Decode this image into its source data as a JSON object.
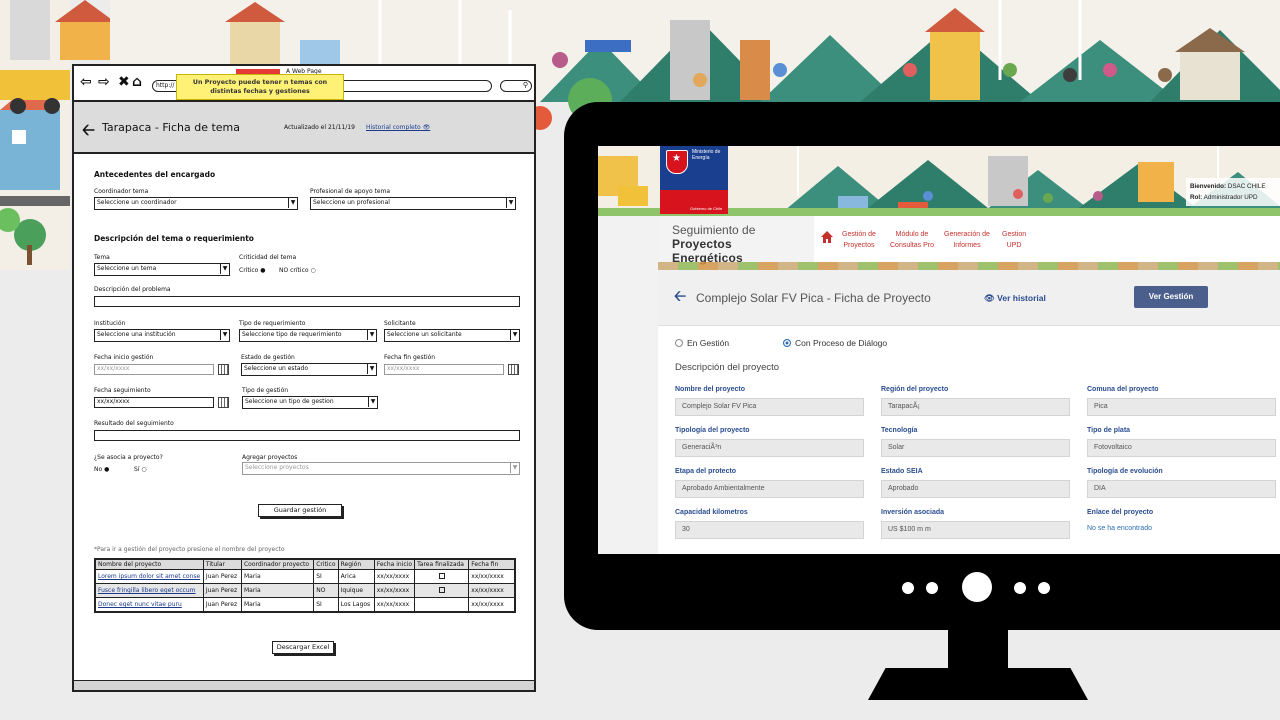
{
  "wireframe": {
    "browser": {
      "nav_icons": [
        "back-arrow-icon",
        "forward-arrow-icon",
        "close-icon",
        "home-icon"
      ],
      "url": "http://",
      "tab_title": "A Web Page",
      "search_icon": "search-icon"
    },
    "sticky_note": "Un Proyecto puede tener n temas con distintas fechas y gestiones",
    "header": {
      "title": "Tarapaca - Ficha de tema",
      "updated": "Actualizado el 21/11/19",
      "history_link": "Historial completo",
      "history_icon": "eye-icon"
    },
    "section1": {
      "title": "Antecedentes del encargado",
      "coordinator_label": "Coordinador tema",
      "coordinator_value": "Seleccione un coordinador",
      "support_label": "Profesional de apoyo tema",
      "support_value": "Seleccione un profesional"
    },
    "section2": {
      "title": "Descripción del tema o requerimiento",
      "topic_label": "Tema",
      "topic_value": "Seleccione un tema",
      "criticality_label": "Criticidad del tema",
      "critical_option": "Crítico",
      "noncritical_option": "NO crítico",
      "problem_label": "Descripción del problema",
      "institution_label": "Institución",
      "institution_value": "Seleccione una institución",
      "reqtype_label": "Tipo de requerimiento",
      "reqtype_value": "Seleccione tipo de requerimiento",
      "applicant_label": "Solicitante",
      "applicant_value": "Seleccione un solicitante",
      "start_label": "Fecha inicio gestión",
      "start_placeholder": "xx/xx/xxxx",
      "status_label": "Estado de gestión",
      "status_value": "Seleccione un estado",
      "end_label": "Fecha fin gestión",
      "end_placeholder": "xx/xx/xxxx",
      "followup_label": "Fecha seguimiento",
      "followup_value": "xx/xx/xxxx",
      "mgmt_type_label": "Tipo de gestión",
      "mgmt_type_value": "Seleccione un tipo de gestion",
      "result_label": "Resultado del seguimiento",
      "associate_label": "¿Se asocia a proyecto?",
      "no_option": "No",
      "yes_option": "Sí",
      "add_projects_label": "Agregar proyectos",
      "add_projects_value": "Seleccione proyectos",
      "save_button": "Guardar gestión"
    },
    "table": {
      "hint": "*Para ir a gestión del proyecto presione el nombre del proyecto",
      "headers": [
        "Nombre del proyecto",
        "Titular",
        "Coordinador proyecto",
        "Critico",
        "Región",
        "Fecha inicio",
        "Tarea finalizada",
        "Fecha fin"
      ],
      "rows": [
        [
          "Lorem ipsum dolor sit amet conse",
          "Juan Perez",
          "Maria",
          "SI",
          "Arica",
          "xx/xx/xxxx",
          "",
          "xx/xx/xxxx"
        ],
        [
          "Fusce fringilla libero eget occum",
          "Juan Perez",
          "Maria",
          "NO",
          "Iquique",
          "xx/xx/xxxx",
          "",
          "xx/xx/xxxx"
        ],
        [
          "Donec eget nunc vitae puru",
          "Juan Perez",
          "Maria",
          "SI",
          "Los Lagos",
          "xx/xx/xxxx",
          "",
          "xx/xx/xxxx"
        ]
      ],
      "export_button": "Descargar Excel"
    }
  },
  "app": {
    "ministry": [
      "Ministerio de",
      "Energía"
    ],
    "government": "Gobierno de Chile",
    "user": {
      "welcome_label": "Bienvenido:",
      "welcome_value": "DSAC CHILE",
      "role_label": "Rol:",
      "role_value": "Administrador UPD"
    },
    "brand": [
      "Seguimiento de",
      "Proyectos Energéticos"
    ],
    "home_icon": "home-icon",
    "menu": [
      [
        "Gestión de",
        "Proyectos"
      ],
      [
        "Módulo de",
        "Consultas Pro"
      ],
      [
        "Generación de",
        "Informes"
      ],
      [
        "Gestion",
        "UPD"
      ]
    ],
    "page": {
      "title": "Complejo Solar FV Pica - Ficha de Proyecto",
      "history": "Ver historial",
      "history_icon": "eye-icon",
      "button": "Ver Gestión",
      "radio_1": "En Gestión",
      "radio_2": "Con Proceso de Diálogo",
      "selected_radio": "Con Proceso de Diálogo",
      "section": "Descripción del proyecto",
      "fields": [
        {
          "label": "Nombre del proyecto",
          "value": "Complejo Solar FV Pica"
        },
        {
          "label": "Región del proyecto",
          "value": "TarapacÃ¡"
        },
        {
          "label": "Comuna del proyecto",
          "value": "Pica"
        },
        {
          "label": "Tipología del proyecto",
          "value": "GeneraciÃ³n"
        },
        {
          "label": "Tecnología",
          "value": "Solar"
        },
        {
          "label": "Tipo de plata",
          "value": "Fotovoltaico"
        },
        {
          "label": "Etapa del protecto",
          "value": "Aprobado Ambientalmente"
        },
        {
          "label": "Estado SEIA",
          "value": "Aprobado"
        },
        {
          "label": "Tipología de evolución",
          "value": "DIA"
        },
        {
          "label": "Capacidad kilometros",
          "value": "30"
        },
        {
          "label": "Inversión asociada",
          "value": "US $100 m m"
        },
        {
          "label": "Enlace del proyecto",
          "value": "No se ha encontrado"
        }
      ]
    }
  },
  "colors": {
    "accent_blue": "#2a4d8f",
    "menu_red": "#c5302c",
    "button_navy": "#4b5f8d",
    "gob_blue": "#1b3f8f",
    "gob_red": "#d7141e",
    "sticky_yellow": "#fff176"
  }
}
